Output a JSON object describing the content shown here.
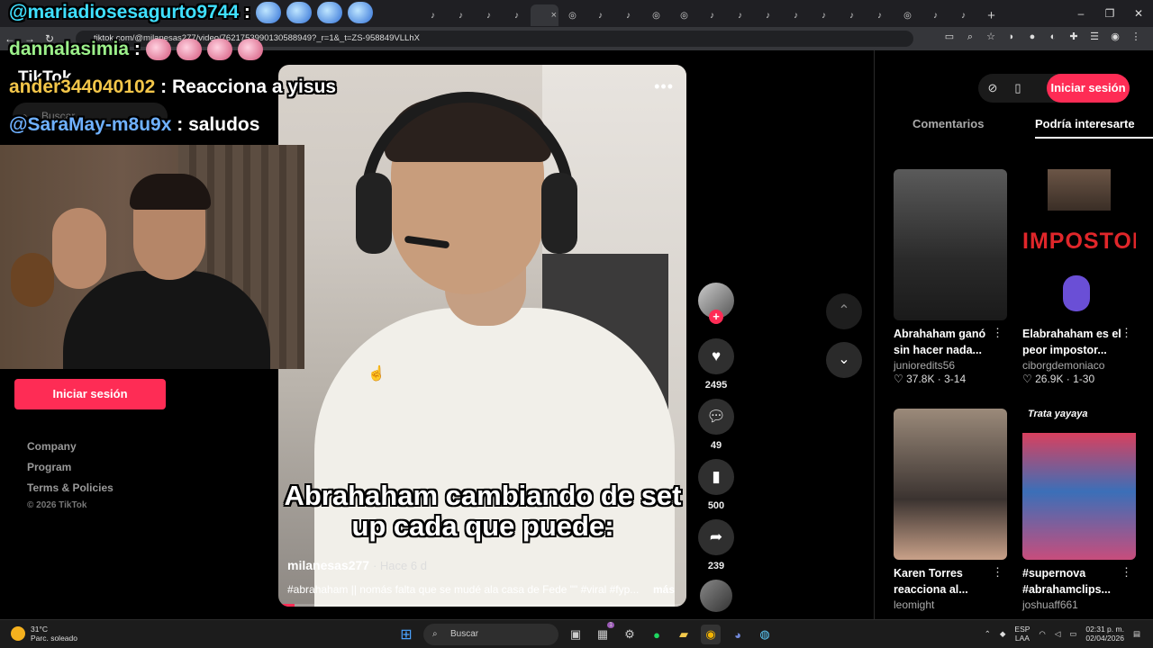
{
  "browser": {
    "tab_icons": [
      "tiktok",
      "tiktok",
      "tiktok",
      "tiktok",
      "tiktok",
      "globe",
      "tiktok",
      "tiktok",
      "globe",
      "globe",
      "tiktok",
      "tiktok",
      "tiktok",
      "tiktok",
      "tiktok",
      "tiktok",
      "tiktok",
      "globe",
      "tiktok",
      "tiktok"
    ],
    "close_tab": "×",
    "new_tab": "+",
    "url": "tiktok.com/@milanesas277/video/7621753990130588949?_r=1&_t=ZS-958849VLLhX"
  },
  "tiktok": {
    "logo": "TikTok",
    "search_placeholder": "Buscar",
    "login": "Iniciar sesión",
    "footer": [
      "Company",
      "Program",
      "Terms & Policies"
    ],
    "copyright": "© 2026 TikTok",
    "video": {
      "caption": "Abrahaham cambiando de set up cada que puede:",
      "author": "milanesas277",
      "posted": "Hace 6 d",
      "description": "#abrahaham || nomás falta que se mudé ala casa de Fede \"\" #viral #fyp...",
      "more": "más",
      "progress": 0.04
    },
    "actions": {
      "likes": "2495",
      "comments": "49",
      "saves": "500",
      "shares": "239"
    },
    "right_panel": {
      "login": "Iniciar sesión",
      "tabs": [
        "Comentarios",
        "Podría interesarte"
      ],
      "cards": [
        {
          "title": "Abrahaham ganó sin hacer nada...",
          "user": "junioredits56",
          "meta": "♡ 37.8K · 3-14"
        },
        {
          "title": "Elabrahaham es el peor impostor...",
          "user": "ciborgdemoniaco",
          "meta": "♡ 26.9K · 1-30",
          "overlay": "IMPOSTOR"
        },
        {
          "title": "Karen Torres reacciona al...",
          "user": "leomight"
        },
        {
          "title": "#supernova #abrahamclips...",
          "user": "joshuaff661",
          "overlay": "Trata yayaya"
        }
      ]
    }
  },
  "stream_chat": [
    {
      "user": "@mariadiosesagurto9744",
      "sep": " :",
      "msg": ""
    },
    {
      "user": "dannalasimia",
      "sep": " :",
      "msg": ""
    },
    {
      "user": "ander344040102",
      "sep": " :",
      "msg": " Reacciona a yisus"
    },
    {
      "user": "@SaraMay-m8u9x",
      "sep": " :",
      "msg": " saludos"
    }
  ],
  "taskbar": {
    "temp": "31°C",
    "weather": "Parc. soleado",
    "search": "Buscar",
    "lang1": "ESP",
    "lang2": "LAA",
    "time": "02:31 p. m.",
    "date": "02/04/2026",
    "badge": "1"
  },
  "colors": {
    "accent": "#fe2c55"
  }
}
